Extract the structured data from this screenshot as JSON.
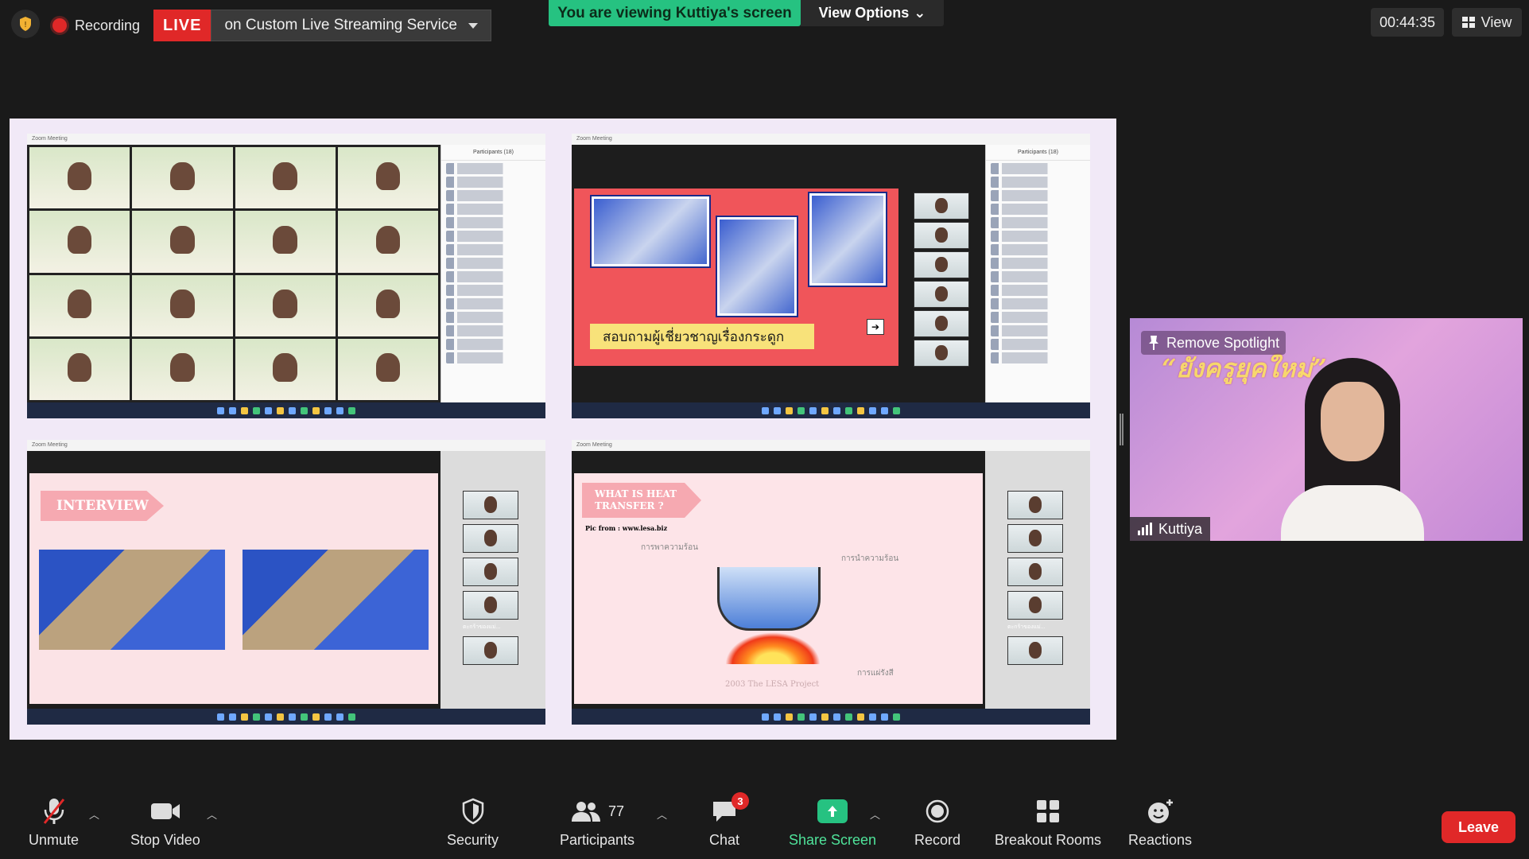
{
  "top_bar": {
    "recording_label": "Recording",
    "live_badge": "LIVE",
    "live_service": "on Custom Live Streaming Service",
    "viewing_banner": "You are viewing Kuttiya's screen",
    "view_options": "View Options",
    "timer": "00:44:35",
    "view_label": "View"
  },
  "shared_screen": {
    "tile1": {
      "titlebar": "Zoom Meeting",
      "panel_title": "Participants (18)"
    },
    "tile2": {
      "titlebar": "Zoom Meeting",
      "panel_title": "Participants (18)",
      "caption": "สอบถามผู้เชี่ยวชาญเรื่องกระดูก"
    },
    "tile3": {
      "titlebar": "Zoom Meeting",
      "tag": "INTERVIEW",
      "thumb_caption": "ตะกร้าของแม่..."
    },
    "tile4": {
      "titlebar": "Zoom Meeting",
      "tag_line1": "WHAT IS HEAT",
      "tag_line2": "TRANSFER ?",
      "pic_from": "Pic from : www.lesa.biz",
      "label_conduction": "การพาความร้อน",
      "label_convection": "การนำความร้อน",
      "label_radiation": "การแผ่รังสี",
      "footer": "2003 The LESA Project",
      "thumb_caption": "ตะกร้าของแม่..."
    }
  },
  "spotlight": {
    "remove_spotlight": "Remove Spotlight",
    "overlay_title": "“ยังครูยุคใหม่”",
    "name": "Kuttiya"
  },
  "toolbar": {
    "unmute": "Unmute",
    "stop_video": "Stop Video",
    "security": "Security",
    "participants": "Participants",
    "participants_count": "77",
    "chat": "Chat",
    "chat_badge": "3",
    "share_screen": "Share Screen",
    "record": "Record",
    "breakout_rooms": "Breakout Rooms",
    "reactions": "Reactions",
    "leave": "Leave"
  },
  "colors": {
    "live_red": "#e02828",
    "zoom_green": "#26c281",
    "background": "#1a1a1a"
  }
}
